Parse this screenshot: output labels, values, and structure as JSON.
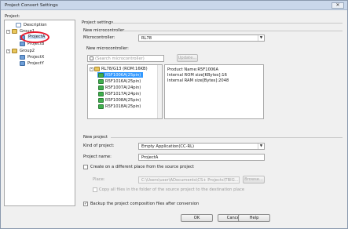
{
  "window": {
    "title": "Project Convert Settings",
    "close_glyph": "✕"
  },
  "left": {
    "label": "Project:",
    "tree": [
      {
        "label": "Description"
      },
      {
        "label": "Group1"
      },
      {
        "label": "ProjectA"
      },
      {
        "label": "ProjectB"
      },
      {
        "label": "Group2"
      },
      {
        "label": "ProjectX"
      },
      {
        "label": "ProjectY"
      }
    ]
  },
  "right": {
    "settings_label": "Project settings",
    "new_micro_label": "New microcontroller",
    "micro_label": "Microcontroller:",
    "micro_value": "RL78",
    "new_micro_list_label": "New microcontroller:",
    "search_placeholder": "(Search microcontroller)",
    "update_button": "Update...",
    "micro_tree": [
      {
        "label": "RL78/G13 (ROM:16KB)"
      },
      {
        "label": "R5F1006A(25pin)"
      },
      {
        "label": "R5F1016A(25pin)"
      },
      {
        "label": "R5F1007A(24pin)"
      },
      {
        "label": "R5F1017A(24pin)"
      },
      {
        "label": "R5F1008A(25pin)"
      },
      {
        "label": "R5F1018A(25pin)"
      }
    ],
    "product_info": [
      "Product Name:R5F1006A",
      "Internal ROM size[KBytes]:16",
      "Internal RAM size[Bytes]:2048"
    ],
    "new_project_label": "New project",
    "kind_label": "Kind of project:",
    "kind_value": "Empty Application(CC-RL)",
    "name_label": "Project name:",
    "name_value": "ProjectA",
    "create_diff_label": "Create on a different place from the source project",
    "place_label": "Place:",
    "place_value": "C:\\Users\\user\\ADocuments\\CS+ Projects\\TBIG...",
    "browse_button": "Browse...",
    "copy_label": "Copy all files in the folder of the source project to the destination place",
    "backup_label": "Backup the project composition files after conversion"
  },
  "footer": {
    "ok": "OK",
    "cancel": "Cancel",
    "help": "Help"
  },
  "colors": {
    "selection": "#3399ff",
    "highlight_circle": "#e8182c"
  }
}
